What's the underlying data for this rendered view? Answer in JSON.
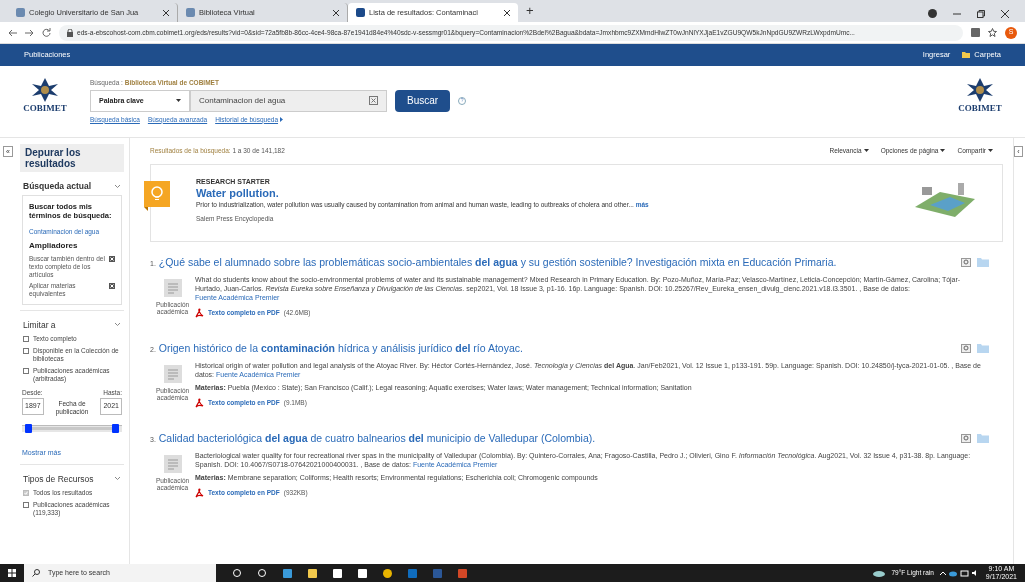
{
  "browser": {
    "tabs": [
      {
        "title": "Colegio Universitario de San Jua",
        "selected": false
      },
      {
        "title": "Biblioteca Virtual",
        "selected": false
      },
      {
        "title": "Lista de resultados: Contaminaci",
        "selected": true
      }
    ],
    "new_tab": "+",
    "url": "eds-a-ebscohost-com.cbm.cobimet1.org/eds/results?vid=0&sid=72a5fb8b-86cc-4ce4-98ca-87e1941d84e4%40sdc-v-sessmgr01&bquery=Contaminacion%2Bdel%2Bagua&bdata=Jmxhbmc9ZXMmdHlwZT0wJnNlYXJjaE1vZGU9QW5kJnNpdGU9ZWRzLWxpdmUmc...",
    "profile": "S"
  },
  "nav": {
    "label": "Publicaciones",
    "links": [
      "Ingresar",
      "Carpeta"
    ]
  },
  "header": {
    "logos": [
      "COBIMET",
      "COBIMET"
    ],
    "search_label": "Búsqueda :",
    "search_source": "Biblioteca Virtual de COBIMET",
    "field_type": "Palabra clave",
    "query": "Contaminacion del agua",
    "button": "Buscar",
    "help": "?",
    "links": [
      "Búsqueda básica",
      "Búsqueda avanzada",
      "Historial de búsqueda"
    ]
  },
  "sidebar": {
    "collapse": "«",
    "title": "Depurar los resultados",
    "current": {
      "heading": "Búsqueda actual",
      "expanded": true,
      "terms_label": "Buscar todos mis términos de búsqueda:",
      "term": "Contaminacion del agua",
      "expanders_label": "Ampliadores",
      "expanders": [
        "Buscar también dentro del texto completo de los artículos",
        "Aplicar materias equivalentes"
      ]
    },
    "limit": {
      "heading": "Limitar a",
      "options": [
        {
          "label": "Texto completo",
          "checked": false
        },
        {
          "label": "Disponible en la Colección de bibliotecas",
          "checked": false
        },
        {
          "label": "Publicaciones académicas (arbitradas)",
          "checked": false
        }
      ],
      "from_label": "Desde:",
      "from": "1897",
      "to_label": "Hasta:",
      "to": "2021",
      "date_label": "Fecha de publicación",
      "level": 1,
      "more": "Mostrar más"
    },
    "types": {
      "heading": "Tipos de Recursos",
      "options": [
        {
          "label": "Todos los resultados",
          "checked": true,
          "disabled": true
        },
        {
          "label": "Publicaciones académicas (119,333)",
          "checked": false,
          "disabled": false
        }
      ]
    }
  },
  "results_header": {
    "label": "Resultados de la búsqueda:",
    "range": "1 a 30 de 141,182",
    "menus": [
      "Relevancia",
      "Opciones de página",
      "Compartir"
    ]
  },
  "right_collapse": "‹",
  "research_starter": {
    "label": "RESEARCH STARTER",
    "title": "Water pollution.",
    "snippet": "Prior to industrialization, water pollution was usually caused by contamination from animal and human waste, leading to outbreaks of cholera and other...",
    "more": "más",
    "source": "Salem Press Encyclopedia"
  },
  "results": [
    {
      "number": "1.",
      "title": "¿Qué sabe el alumnado sobre las problemáticas socio-ambientales **del agua** y su gestión sostenible? Investigación mixta en Educación Primaria.",
      "abstract": "What do students know about the socio-environmental problems of water and its sustainable management? Mixed Research in Primary Education. By: Pozo-Muñoz, María-Paz; Velasco-Martínez, Leticia-Concepción; Martín-Gámez, Carolina; Tójar-Hurtado, Juan-Carlos. *Revista Eureka sobre Enseñanza y Divulgación de las Ciencias*. sep2021, Vol. 18 Issue 3, p1-16. 16p. Language: Spanish. DOI: 10.25267/Rev_Eureka_ensen_divulg_cienc.2021.v18.i3.3501. , Base de datos:",
      "database": "Fuente Académica Premier",
      "type": "Publicación académica",
      "pdf": "Texto completo en PDF",
      "size": "(42.6MB)"
    },
    {
      "number": "2.",
      "title": "Origen histórico de la **contaminación** hídrica y análisis jurídico **del** río Atoyac.",
      "abstract": "Historical origin of water pollution and legal analysis of the Atoyac River. By: Héctor Cortés-Hernández, José. *Tecnología y Ciencias* **del Agua**. Jan/Feb2021, Vol. 12 Issue 1, p133-191. 59p. Language: Spanish. DOI: 10.24850/j-tyca-2021-01-05. , Base de datos:",
      "database": "Fuente Académica Premier",
      "subjects": "**Materias:** Puebla (Mexico : State); San Francisco (Calif.); Legal reasoning; Aquatic exercises; Water laws; Water management; Technical information; Sanitation",
      "type": "Publicación académica",
      "pdf": "Texto completo en PDF",
      "size": "(9.1MB)"
    },
    {
      "number": "3.",
      "title": "Calidad bacteriológica **del agua** de cuatro balnearios **del** municipio de Valledupar (Colombia).",
      "abstract": "Bacteriological water quality for four recreational river spas in the municipality of Valledupar (Colombia). By: Quintero-Corrales, Ana; Fragoso-Castilla, Pedro J.; Olivieri, Gino F. *Información Tecnológica*. Aug2021, Vol. 32 Issue 4, p31-38. 8p. Language: Spanish. DOI: 10.4067/S0718-07642021000400031. , Base de datos:",
      "database": "Fuente Académica Premier",
      "subjects": "**Materias:** Membrane separation; Coliforms; Health resorts; Environmental regulations; Escherichia coli; Chromogenic compounds",
      "type": "Publicación académica",
      "pdf": "Texto completo en PDF",
      "size": "(932KB)"
    }
  ],
  "taskbar": {
    "search": "Type here to search",
    "weather": "79°F Light rain",
    "time": "9:10 AM",
    "date": "9/17/2021"
  }
}
